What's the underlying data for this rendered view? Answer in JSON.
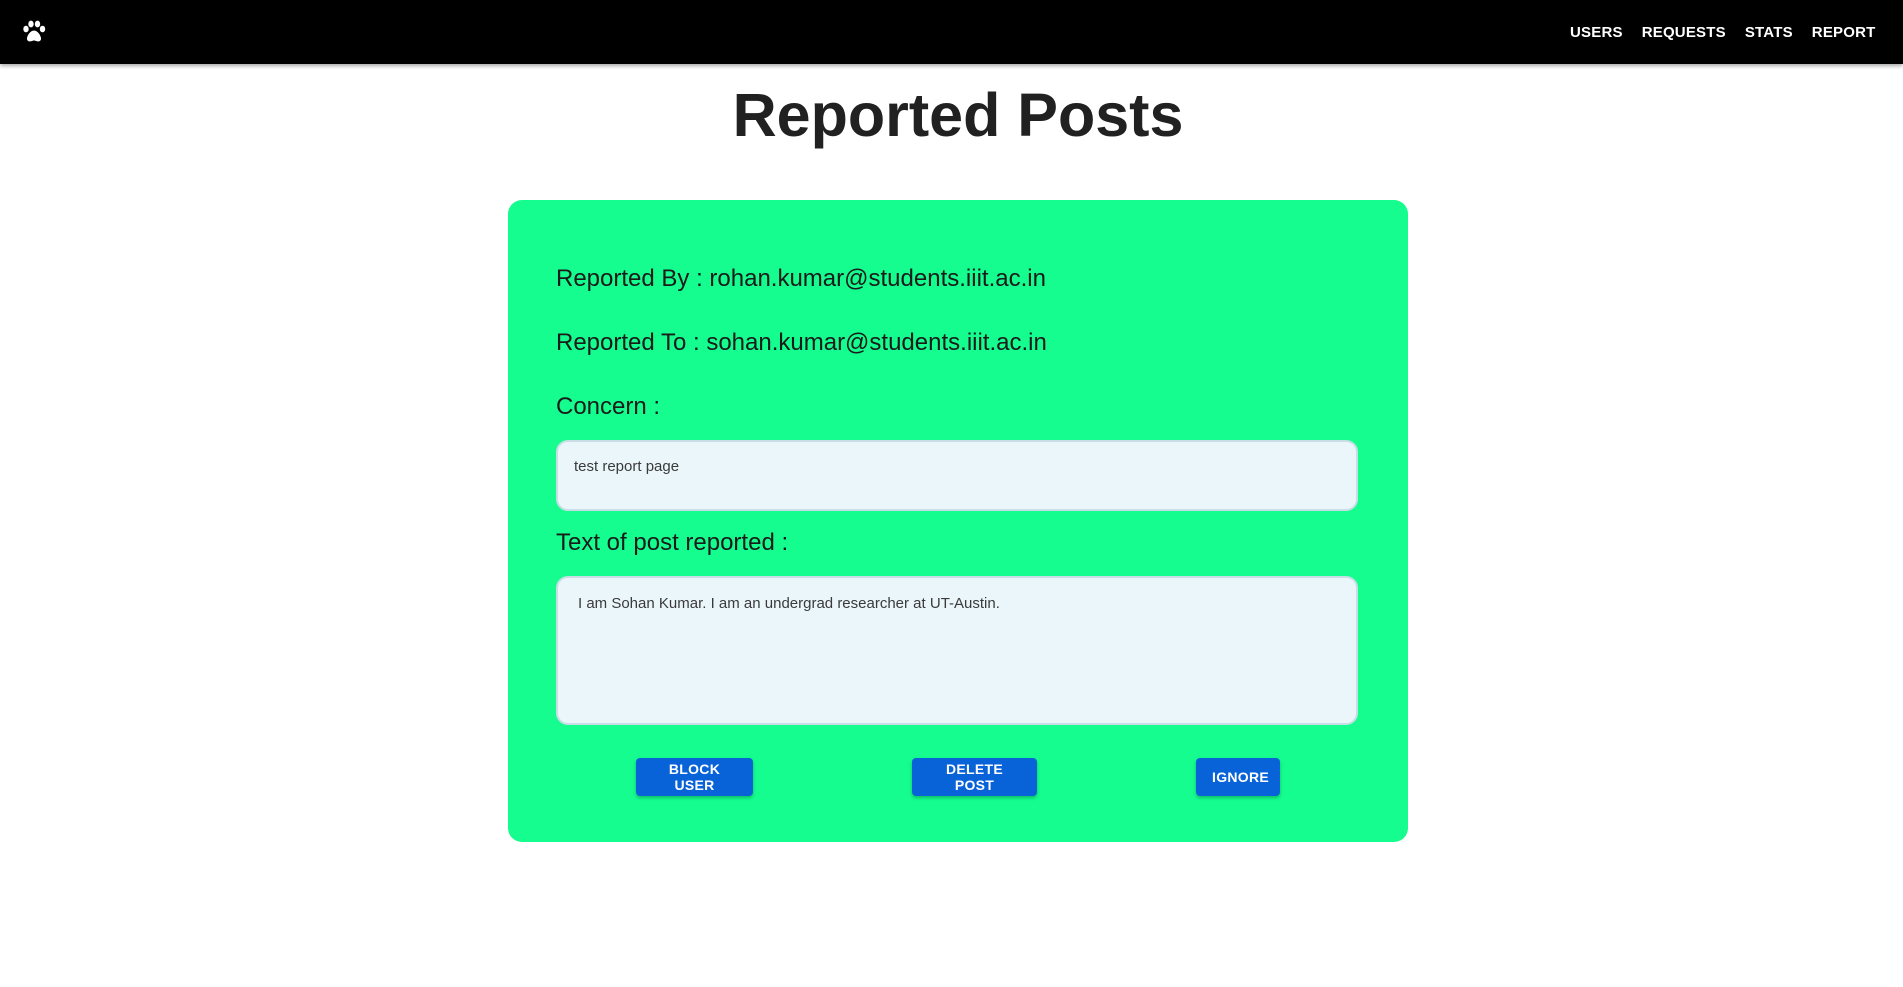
{
  "appbar": {
    "logo_icon": "paw-icon",
    "nav": [
      "USERS",
      "REQUESTS",
      "STATS",
      "REPORT"
    ]
  },
  "page": {
    "title": "Reported Posts"
  },
  "report": {
    "reported_by_label": "Reported By : rohan.kumar@students.iiit.ac.in",
    "reported_to_label": "Reported To : sohan.kumar@students.iiit.ac.in",
    "concern_label": "Concern :",
    "concern_text": "test report page",
    "post_text_label": "Text of post reported :",
    "post_text": "I am Sohan Kumar. I am an undergrad researcher at UT-Austin."
  },
  "actions": {
    "block_label": "BLOCK USER",
    "delete_label": "DELETE POST",
    "ignore_label": "IGNORE"
  },
  "colors": {
    "appbar": "#000000",
    "card": "#14fd8e",
    "textbox": "#ebf6fb",
    "button": "#0863d9"
  }
}
